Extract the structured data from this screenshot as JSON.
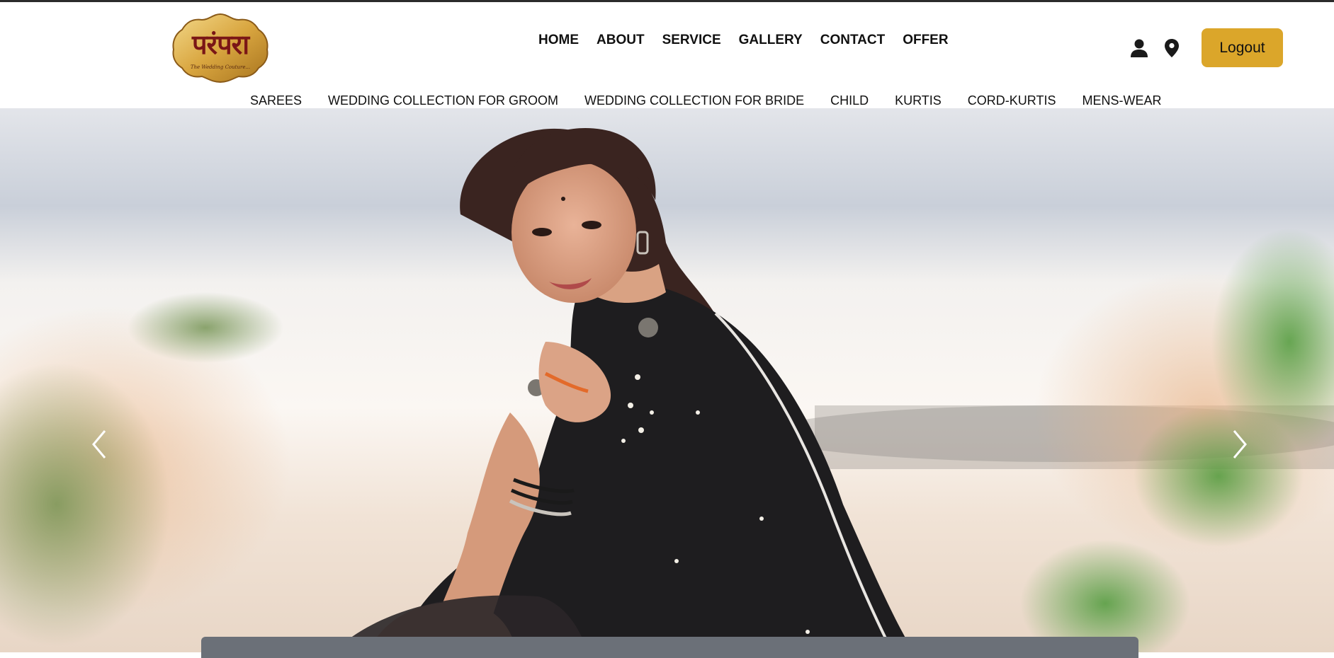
{
  "logo": {
    "text": "परंपरा",
    "tagline": "The Wedding Couture..."
  },
  "main_nav": [
    {
      "label": "HOME"
    },
    {
      "label": "ABOUT"
    },
    {
      "label": "SERVICE"
    },
    {
      "label": "GALLERY"
    },
    {
      "label": "CONTACT"
    },
    {
      "label": "OFFER"
    }
  ],
  "header_icons": [
    "user-icon",
    "location-pin-icon"
  ],
  "logout_label": "Logout",
  "category_nav": [
    {
      "label": "SAREES"
    },
    {
      "label": "WEDDING COLLECTION FOR GROOM"
    },
    {
      "label": "WEDDING COLLECTION FOR BRIDE"
    },
    {
      "label": "CHILD"
    },
    {
      "label": "KURTIS"
    },
    {
      "label": "CORD-KURTIS"
    },
    {
      "label": "MENS-WEAR"
    }
  ],
  "hero": {
    "carousel_prev_icon": "chevron-left-icon",
    "carousel_next_icon": "chevron-right-icon"
  },
  "colors": {
    "accent": "#dba62a",
    "text": "#111111",
    "logo_text": "#7a1616",
    "caption_bar": "#6b7078"
  }
}
